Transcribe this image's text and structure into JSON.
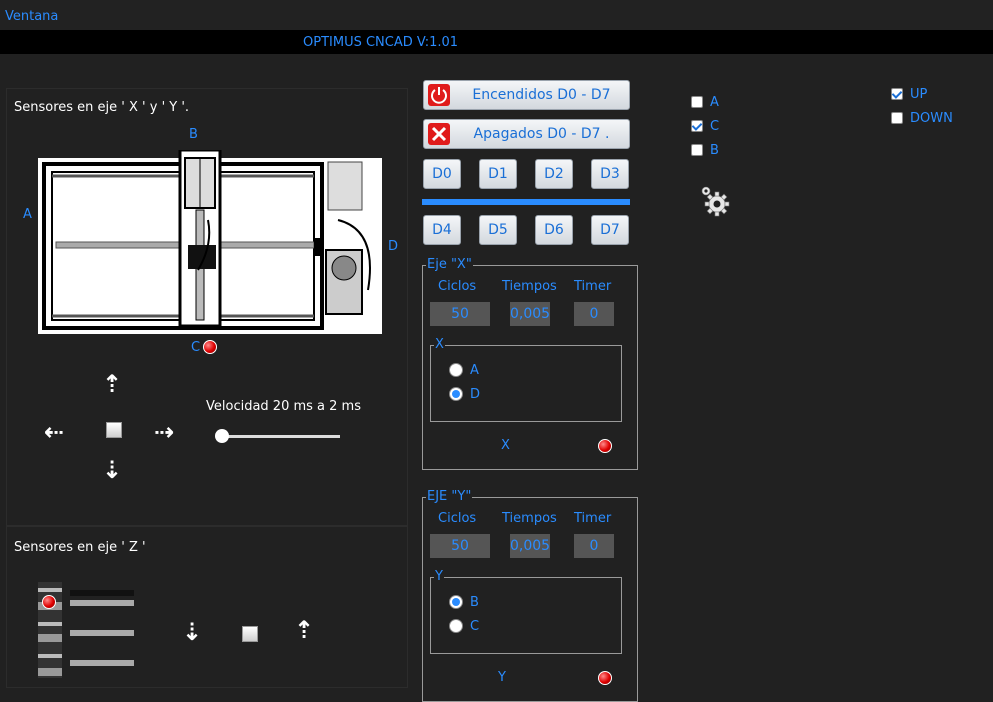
{
  "menu": {
    "ventana": "Ventana"
  },
  "window_title": "OPTIMUS CNCAD V:1.01",
  "xy_panel": {
    "title": "Sensores en eje ' X ' y ' Y '.",
    "label_a": "A",
    "label_b": "B",
    "label_c": "C",
    "label_d": "D",
    "speed_label": "Velocidad 20 ms a 2 ms",
    "speed_value": 0
  },
  "z_panel": {
    "title": "Sensores en eje ' Z '"
  },
  "buttons": {
    "encendidos": "Encendidos D0 - D7",
    "apagados": "Apagados D0 - D7 .",
    "d_row1": [
      "D0",
      "D1",
      "D2",
      "D3"
    ],
    "d_row2": [
      "D4",
      "D5",
      "D6",
      "D7"
    ]
  },
  "eje_x": {
    "title": "Eje \"X\"",
    "headers": [
      "Ciclos",
      "Tiempos",
      "Timer"
    ],
    "ciclos": "50",
    "tiempos": "0,005",
    "timer": "0",
    "sub_title": "X",
    "opt_a": "A",
    "opt_d": "D",
    "selected": "D",
    "status_label": "X"
  },
  "eje_y": {
    "title": "EJE \"Y\"",
    "headers": [
      "Ciclos",
      "Tiempos",
      "Timer"
    ],
    "ciclos": "50",
    "tiempos": "0,005",
    "timer": "0",
    "sub_title": "Y",
    "opt_b": "B",
    "opt_c": "C",
    "selected": "B",
    "status_label": "Y"
  },
  "checks": [
    {
      "label": "A",
      "checked": false
    },
    {
      "label": "C",
      "checked": true
    },
    {
      "label": "B",
      "checked": false
    }
  ],
  "direction": [
    {
      "label": "UP",
      "checked": true
    },
    {
      "label": "DOWN",
      "checked": false
    }
  ],
  "colors": {
    "accent": "#2a8cff",
    "background": "#212121",
    "led_red": "#e00000"
  },
  "icons": {
    "power": "power-icon",
    "cancel": "close-icon",
    "settings": "gears-icon"
  }
}
